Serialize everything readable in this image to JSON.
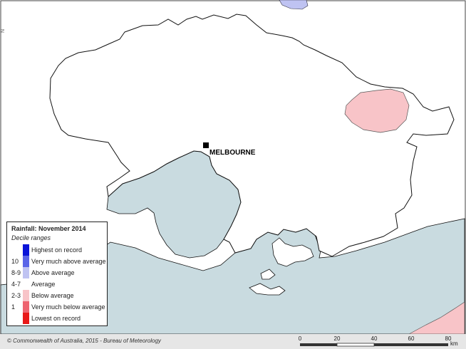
{
  "city": {
    "name": "MELBOURNE"
  },
  "legend": {
    "title": "Rainfall: November 2014",
    "subtitle": "Decile ranges",
    "items": [
      {
        "code": "",
        "label": "Highest on record",
        "color": "#0a14d8"
      },
      {
        "code": "10",
        "label": "Very much above average",
        "color": "#5a64e8"
      },
      {
        "code": "8-9",
        "label": "Above average",
        "color": "#bfc3f2"
      },
      {
        "code": "4-7",
        "label": "Average",
        "color": "#ffffff"
      },
      {
        "code": "2-3",
        "label": "Below average",
        "color": "#f8c4c8"
      },
      {
        "code": "1",
        "label": "Very much below average",
        "color": "#ee6470"
      },
      {
        "code": "",
        "label": "Lowest on record",
        "color": "#e81818"
      }
    ]
  },
  "footer": {
    "copyright": "© Commonwealth of Australia, 2015 - Bureau of Meteorology"
  },
  "scale": {
    "ticks": [
      "0",
      "20",
      "40",
      "60",
      "80"
    ],
    "unit": "km"
  },
  "colors": {
    "sea": "#c9dbe0",
    "land": "#ffffff",
    "below_average": "#f8c4c8",
    "above_average": "#bfc3f2",
    "outline": "#111111"
  }
}
